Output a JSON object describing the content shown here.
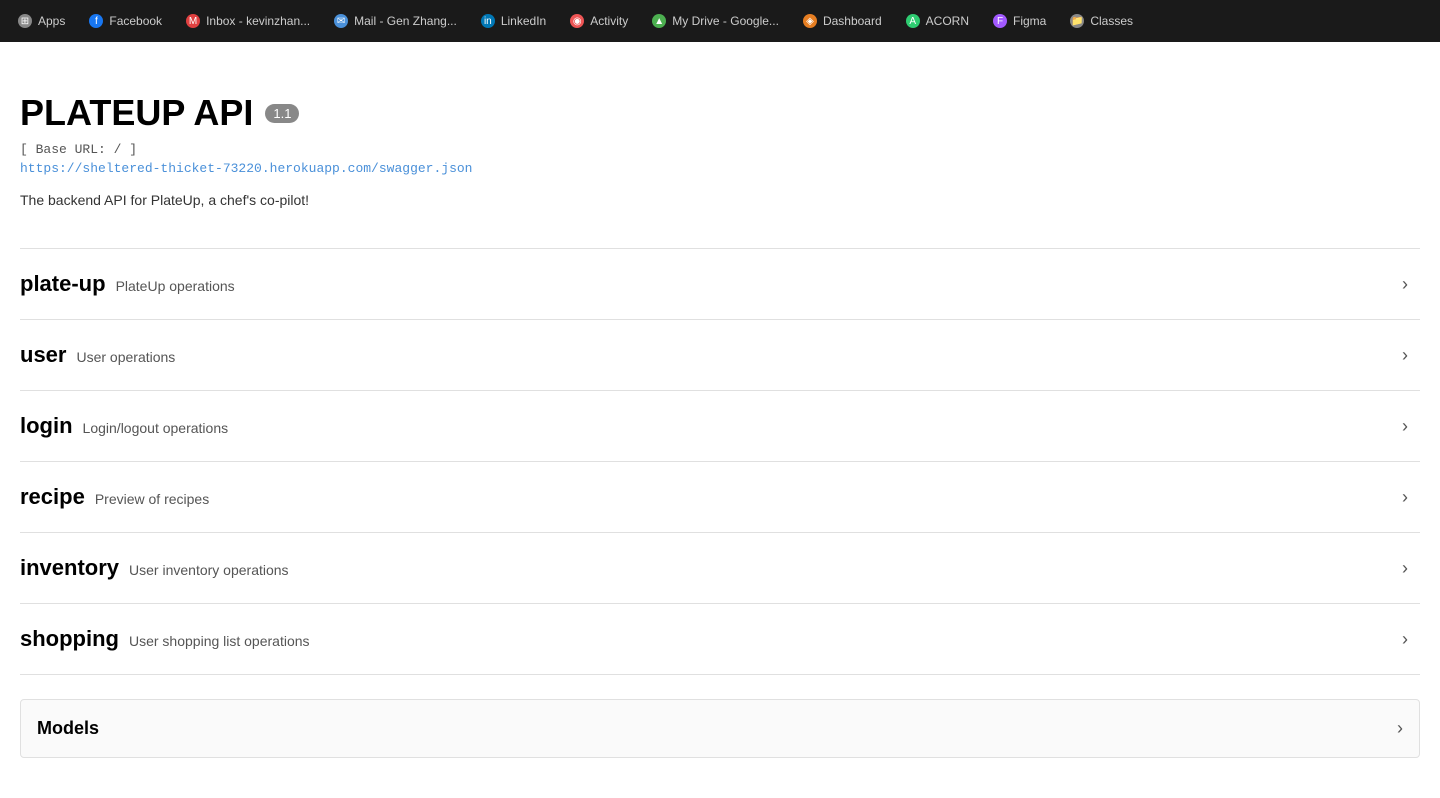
{
  "browser": {
    "tabs": [
      {
        "id": "apps",
        "label": "Apps",
        "icon_color": "#888",
        "icon_char": "⊞"
      },
      {
        "id": "facebook",
        "label": "Facebook",
        "icon_color": "#1877f2",
        "icon_char": "f"
      },
      {
        "id": "inbox",
        "label": "Inbox - kevinzhan...",
        "icon_color": "#e04040",
        "icon_char": "M"
      },
      {
        "id": "mail",
        "label": "Mail - Gen Zhang...",
        "icon_color": "#4a90d9",
        "icon_char": "✉"
      },
      {
        "id": "linkedin",
        "label": "LinkedIn",
        "icon_color": "#0077b5",
        "icon_char": "in"
      },
      {
        "id": "activity",
        "label": "Activity",
        "icon_color": "#e55",
        "icon_char": "◉"
      },
      {
        "id": "mydrive",
        "label": "My Drive - Google...",
        "icon_color": "#4caf50",
        "icon_char": "▲"
      },
      {
        "id": "dashboard",
        "label": "Dashboard",
        "icon_color": "#e67e22",
        "icon_char": "◈"
      },
      {
        "id": "acorn",
        "label": "ACORN",
        "icon_color": "#2ecc71",
        "icon_char": "A"
      },
      {
        "id": "figma",
        "label": "Figma",
        "icon_color": "#a259ff",
        "icon_char": "F"
      },
      {
        "id": "classes",
        "label": "Classes",
        "icon_color": "#888",
        "icon_char": "📁"
      }
    ]
  },
  "api": {
    "title": "PLATEUP API",
    "version": "1.1",
    "base_url_label": "[ Base URL: / ]",
    "base_url": "https://sheltered-thicket-73220.herokuapp.com/swagger.json",
    "description": "The backend API for PlateUp, a chef's co-pilot!"
  },
  "sections": [
    {
      "id": "plate-up",
      "name": "plate-up",
      "description": "PlateUp operations"
    },
    {
      "id": "user",
      "name": "user",
      "description": "User operations"
    },
    {
      "id": "login",
      "name": "login",
      "description": "Login/logout operations"
    },
    {
      "id": "recipe",
      "name": "recipe",
      "description": "Preview of recipes"
    },
    {
      "id": "inventory",
      "name": "inventory",
      "description": "User inventory operations"
    },
    {
      "id": "shopping",
      "name": "shopping",
      "description": "User shopping list operations"
    }
  ],
  "models": {
    "label": "Models"
  },
  "icons": {
    "chevron": "›"
  }
}
